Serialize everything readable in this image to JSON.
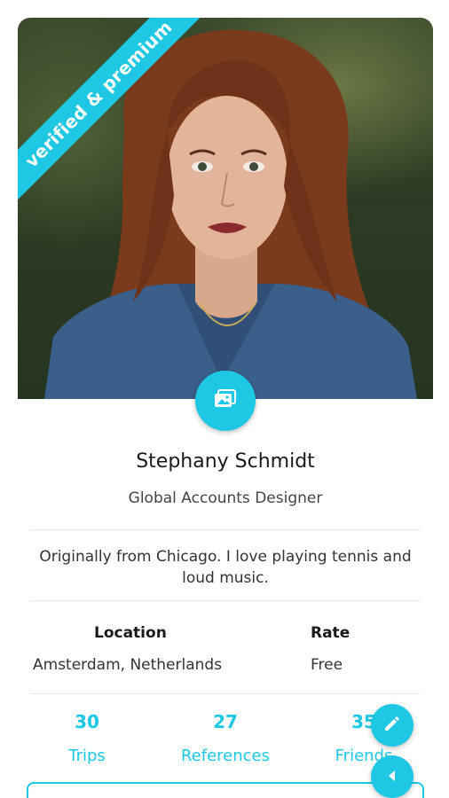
{
  "profile": {
    "badge": "verified & premium",
    "name": "Stephany Schmidt",
    "job_title": "Global Accounts Designer",
    "bio": "Originally from Chicago. I love playing tennis and loud music."
  },
  "info": {
    "location_label": "Location",
    "location_value": "Amsterdam, Netherlands",
    "rate_label": "Rate",
    "rate_value": "Free"
  },
  "stats": [
    {
      "value": "30",
      "label": "Trips"
    },
    {
      "value": "27",
      "label": "References"
    },
    {
      "value": "35",
      "label": "Friends"
    }
  ],
  "colors": {
    "accent": "#1ec8e4"
  },
  "icons": {
    "photo_button": "gallery-icon",
    "edit_fab": "pencil-icon",
    "back_fab": "left-triangle-icon"
  }
}
